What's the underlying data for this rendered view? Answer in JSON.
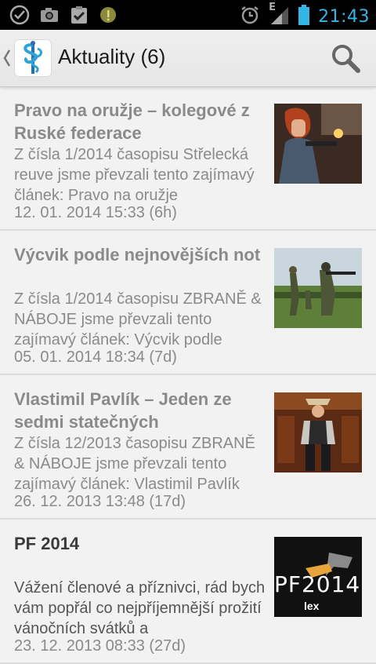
{
  "status_bar": {
    "time": "21:43",
    "network_type": "E",
    "icons": [
      "check-circle-icon",
      "camera-icon",
      "clipboard-check-icon",
      "info-coin-icon",
      "alarm-icon",
      "signal-icon",
      "battery-icon"
    ]
  },
  "action_bar": {
    "title": "Aktuality (6)",
    "logo": "caduceus-logo",
    "search_icon": "search-icon"
  },
  "articles": [
    {
      "title": "Pravo na oružje – kolegové z Ruské federace",
      "description": "Z čísla 1/2014 časopisu Střelecká reuve jsme převzali tento zajímavý článek: Pravo na oružje",
      "date": "12. 01. 2014 15:33 (6h)",
      "read": true
    },
    {
      "title": "Výcvik podle nejnovějších not",
      "description": "Z čísla 1/2014 časopisu ZBRANĚ & NÁBOJE jsme převzali tento zajímavý článek: Výcvik podle",
      "date": "05. 01. 2014 18:34 (7d)",
      "read": true
    },
    {
      "title": "Vlastimil Pavlík – Jeden ze sedmi statečných",
      "description": "Z čísla 12/2013 časopisu ZBRANĚ & NÁBOJE jsme převzali tento zajímavý článek: Vlastimil Pavlík",
      "date": "26. 12. 2013 13:48 (17d)",
      "read": true
    },
    {
      "title": "PF 2014",
      "description": "Vážení členové a příznivci, rád bych vám popřál co nejpříjemnější prožití vánočních svátků a",
      "date": "23. 12. 2013 08:33 (27d)",
      "read": false,
      "thumb_text": "PF2014",
      "thumb_brand": "lex"
    }
  ],
  "colors": {
    "status_accent": "#33b5e5",
    "read_text": "#8a8a8a",
    "unread_title": "#3a3a3a"
  }
}
